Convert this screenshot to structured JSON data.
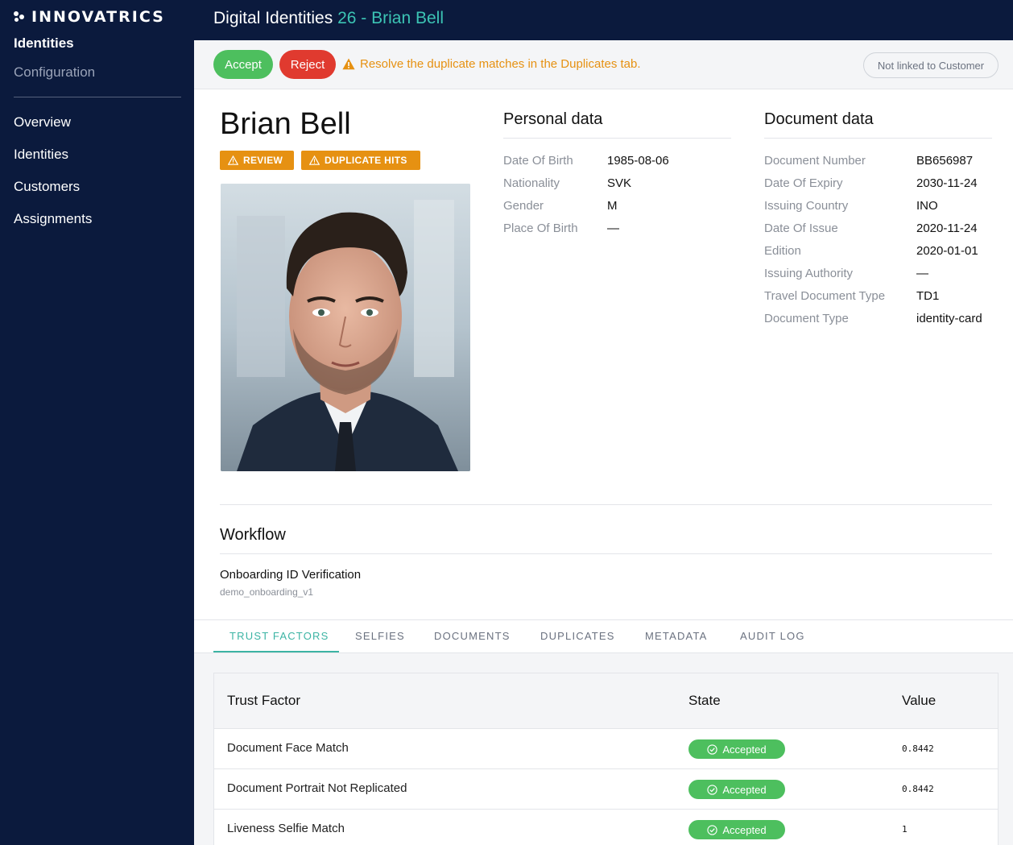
{
  "brand": {
    "name": "INNOVATRICS"
  },
  "sidebar": {
    "top": [
      {
        "label": "Identities",
        "active": true
      },
      {
        "label": "Configuration",
        "active": false
      }
    ],
    "nav": [
      {
        "label": "Overview"
      },
      {
        "label": "Identities"
      },
      {
        "label": "Customers"
      },
      {
        "label": "Assignments"
      }
    ]
  },
  "header": {
    "title": "Digital Identities",
    "identity_ref": "26 - Brian Bell"
  },
  "actions": {
    "accept_label": "Accept",
    "reject_label": "Reject",
    "warning": "Resolve the duplicate matches in the Duplicates tab.",
    "customer_link": "Not linked to Customer"
  },
  "identity": {
    "name": "Brian Bell",
    "badges": [
      "REVIEW",
      "DUPLICATE HITS"
    ]
  },
  "personal": {
    "title": "Personal data",
    "rows": [
      {
        "key": "Date Of Birth",
        "value": "1985-08-06"
      },
      {
        "key": "Nationality",
        "value": "SVK"
      },
      {
        "key": "Gender",
        "value": "M"
      },
      {
        "key": "Place Of Birth",
        "value": "—"
      }
    ]
  },
  "document": {
    "title": "Document data",
    "rows": [
      {
        "key": "Document Number",
        "value": "BB656987"
      },
      {
        "key": "Date Of Expiry",
        "value": "2030-11-24"
      },
      {
        "key": "Issuing Country",
        "value": "INO"
      },
      {
        "key": "Date Of Issue",
        "value": "2020-11-24"
      },
      {
        "key": "Edition",
        "value": "2020-01-01"
      },
      {
        "key": "Issuing Authority",
        "value": "—"
      },
      {
        "key": "Travel Document Type",
        "value": "TD1"
      },
      {
        "key": "Document Type",
        "value": "identity-card"
      }
    ]
  },
  "workflow": {
    "title": "Workflow",
    "name": "Onboarding ID Verification",
    "id": "demo_onboarding_v1"
  },
  "tabs": [
    {
      "label": "TRUST FACTORS",
      "active": true
    },
    {
      "label": "SELFIES",
      "active": false
    },
    {
      "label": "DOCUMENTS",
      "active": false
    },
    {
      "label": "DUPLICATES",
      "active": false
    },
    {
      "label": "METADATA",
      "active": false
    },
    {
      "label": "AUDIT LOG",
      "active": false
    }
  ],
  "trust_table": {
    "headers": {
      "factor": "Trust Factor",
      "state": "State",
      "value": "Value"
    },
    "rows": [
      {
        "factor": "Document Face Match",
        "state": "Accepted",
        "value": "0.8442"
      },
      {
        "factor": "Document Portrait Not Replicated",
        "state": "Accepted",
        "value": "0.8442"
      },
      {
        "factor": "Liveness Selfie Match",
        "state": "Accepted",
        "value": "1"
      }
    ]
  },
  "colors": {
    "navy": "#0b1a3d",
    "teal": "#3cc4b4",
    "accept_green": "#4dbf5e",
    "reject_red": "#e03a2f",
    "warning_orange": "#e69112"
  }
}
